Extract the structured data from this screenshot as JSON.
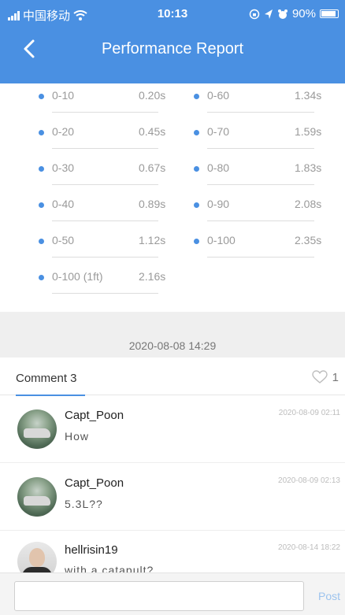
{
  "status": {
    "carrier": "中国移动",
    "time": "10:13",
    "battery": "90%"
  },
  "nav": {
    "title": "Performance Report"
  },
  "metrics": [
    {
      "label": "0-10",
      "value": "0.20s"
    },
    {
      "label": "0-60",
      "value": "1.34s"
    },
    {
      "label": "0-20",
      "value": "0.45s"
    },
    {
      "label": "0-70",
      "value": "1.59s"
    },
    {
      "label": "0-30",
      "value": "0.67s"
    },
    {
      "label": "0-80",
      "value": "1.83s"
    },
    {
      "label": "0-40",
      "value": "0.89s"
    },
    {
      "label": "0-90",
      "value": "2.08s"
    },
    {
      "label": "0-50",
      "value": "1.12s"
    },
    {
      "label": "0-100",
      "value": "2.35s"
    },
    {
      "label": "0-100 (1ft)",
      "value": "2.16s"
    }
  ],
  "report_date": "2020-08-08 14:29",
  "comments_header": {
    "tab_label": "Comment 3",
    "like_count": "1"
  },
  "comments": [
    {
      "user": "Capt_Poon",
      "text": "How",
      "time": "2020-08-09 02:11"
    },
    {
      "user": "Capt_Poon",
      "text": "5.3L??",
      "time": "2020-08-09 02:13"
    },
    {
      "user": "hellrisin19",
      "text": "with a catapult?",
      "time": "2020-08-14 18:22"
    }
  ],
  "input": {
    "placeholder": "",
    "post_label": "Post"
  },
  "colors": {
    "accent": "#4a90e2",
    "text_muted": "#9a9a9a",
    "band": "#efefef"
  }
}
